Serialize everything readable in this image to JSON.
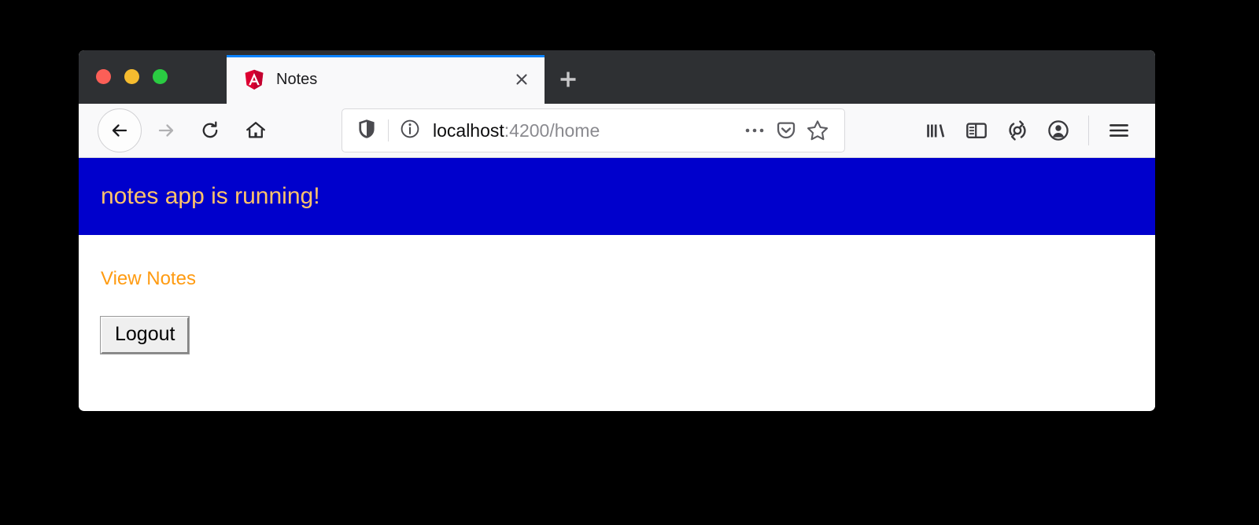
{
  "window": {
    "controls": [
      {
        "name": "close",
        "color": "#fc5f57"
      },
      {
        "name": "minimize",
        "color": "#f6bc2f"
      },
      {
        "name": "maximize",
        "color": "#2acb42"
      }
    ]
  },
  "tabs": {
    "active": {
      "title": "Notes",
      "favicon": "angular-icon",
      "close_label": "×"
    },
    "new_tab_label": "+"
  },
  "toolbar": {
    "back_icon": "back-arrow-icon",
    "forward_icon": "forward-arrow-icon",
    "reload_icon": "reload-icon",
    "home_icon": "home-icon",
    "library_icon": "library-icon",
    "sidebar_icon": "sidebar-icon",
    "sync_icon": "sync-icon",
    "account_icon": "account-icon",
    "menu_icon": "hamburger-menu-icon"
  },
  "url_bar": {
    "shield_icon": "tracking-protection-shield-icon",
    "info_icon": "page-info-icon",
    "host": "localhost",
    "path": ":4200/home",
    "full_url": "localhost:4200/home",
    "page_actions_icon": "ellipsis-icon",
    "pocket_icon": "pocket-icon",
    "bookmark_icon": "star-bookmark-icon"
  },
  "page": {
    "banner": {
      "title": "notes app is running!",
      "background": "#0000cc",
      "text_color": "#ffc36b"
    },
    "view_notes_link": "View Notes",
    "view_notes_color": "#ff9b11",
    "logout_button": "Logout"
  }
}
